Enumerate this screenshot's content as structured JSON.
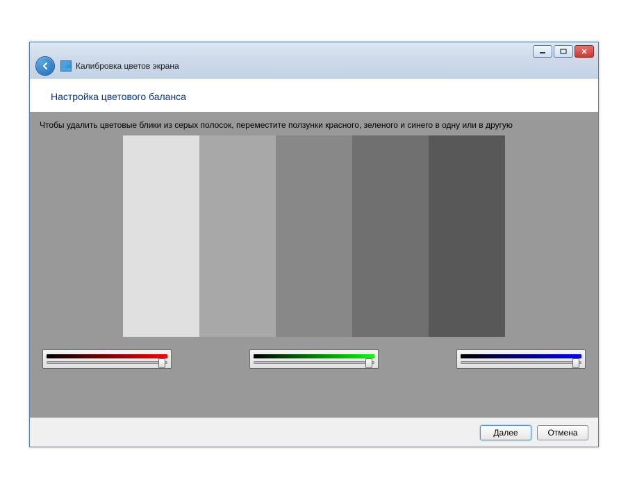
{
  "window": {
    "title": "Калибровка цветов экрана"
  },
  "page": {
    "heading": "Настройка цветового баланса",
    "instruction": "Чтобы удалить цветовые блики из серых полосок, переместите ползунки красного, зеленого и синего в одну или в другую"
  },
  "gray_bars": [
    "#e0e0e0",
    "#a8a8a8",
    "#888888",
    "#707070",
    "#585858"
  ],
  "sliders": {
    "red": {
      "gradient": "linear-gradient(to right, #000000, #ff0000)",
      "value": 100
    },
    "green": {
      "gradient": "linear-gradient(to right, #000000, #00ff00)",
      "value": 100
    },
    "blue": {
      "gradient": "linear-gradient(to right, #000000, #0000ff)",
      "value": 100
    }
  },
  "footer": {
    "next": "Далее",
    "cancel": "Отмена"
  }
}
